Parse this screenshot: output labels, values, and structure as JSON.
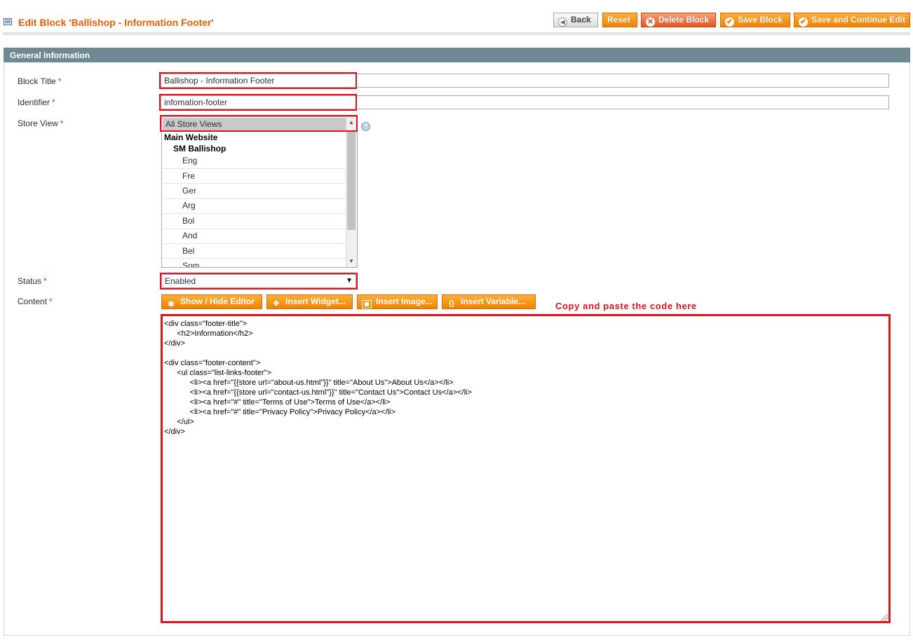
{
  "header": {
    "title": "Edit Block 'Ballishop - Information Footer'",
    "buttons": {
      "back": "Back",
      "reset": "Reset",
      "delete": "Delete Block",
      "save": "Save Block",
      "save_continue": "Save and Continue Edit"
    }
  },
  "section": {
    "title": "General Information"
  },
  "fields": {
    "block_title": {
      "label": "Block Title",
      "required": "*",
      "value": "Ballishop - Information Footer"
    },
    "identifier": {
      "label": "Identifier",
      "required": "*",
      "value": "infomation-footer"
    },
    "store_view": {
      "label": "Store View",
      "required": "*",
      "selected": "All Store Views",
      "website": "Main Website",
      "store": "SM Ballishop",
      "options": [
        "Eng",
        "Fre",
        "Ger",
        "Arg",
        "Bol",
        "And",
        "Bel",
        "Som"
      ]
    },
    "status": {
      "label": "Status",
      "required": "*",
      "value": "Enabled"
    },
    "content": {
      "label": "Content",
      "required": "*",
      "buttons": {
        "show_hide": "Show / Hide Editor",
        "widget": "Insert Widget...",
        "image": "Insert Image...",
        "variable": "Insert Variable..."
      },
      "annotation": "Copy and paste the code here",
      "value": "<div class=\"footer-title\">\n      <h2>Information</h2>\n</div>\n\n<div class=\"footer-content\">\n      <ul class=\"list-links-footer\">\n            <li><a href=\"{{store url=\"about-us.html\"}}\" title=\"About Us\">About Us</a></li>\n            <li><a href=\"{{store url=\"contact-us.html\"}}\" title=\"Contact Us\">Contact Us</a></li>\n            <li><a href=\"#\" title=\"Terms of Use\">Terms of Use</a></li>\n            <li><a href=\"#\" title=\"Privacy Policy\">Privacy Policy</a></li>\n      </ul>\n</div>"
    }
  },
  "colors": {
    "title_orange": "#eb5e00",
    "button_orange": "#f18200",
    "section_bar": "#6f8992",
    "highlight_red": "#e0141e"
  },
  "icons": {
    "page": "grid-icon",
    "back": "arrow-left-icon",
    "delete": "x-circle-icon",
    "save": "check-circle-icon",
    "help": "help-icon",
    "show_hide": "eye-icon",
    "widget": "widget-icon",
    "image": "image-icon",
    "variable": "variable-icon"
  }
}
